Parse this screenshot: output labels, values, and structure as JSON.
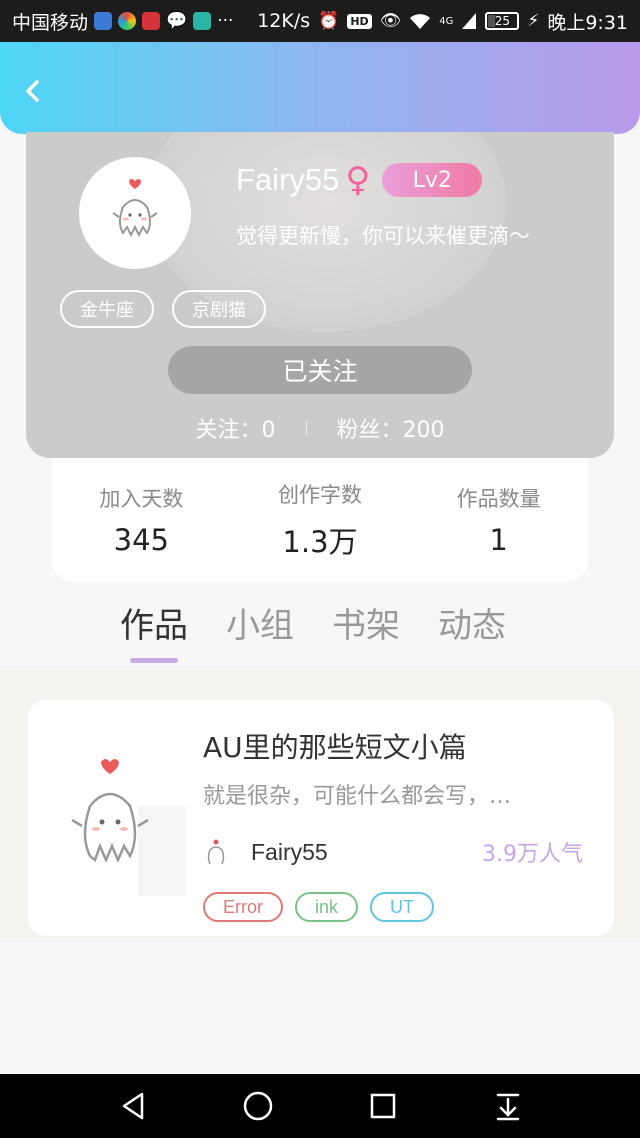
{
  "status_bar": {
    "carrier": "中国移动",
    "network_speed": "12K/s",
    "hd_label": "HD",
    "signal_label": "4G",
    "battery": "25",
    "battery_level": 0.25,
    "time": "晚上9:31"
  },
  "header": {
    "back_icon": "chevron-left-icon",
    "gradient": [
      "#4dd6f6",
      "#b99ae9"
    ]
  },
  "profile": {
    "name": "Fairy55",
    "gender_symbol": "♀",
    "level": "Lv2",
    "bio": "觉得更新慢，你可以来催更滴～",
    "tags": [
      "金牛座",
      "京剧猫"
    ],
    "follow_button": "已关注",
    "following": "关注：0",
    "fans": "粉丝：200"
  },
  "stats": [
    {
      "label": "加入天数",
      "value": "345"
    },
    {
      "label": "创作字数",
      "value": "1.3万"
    },
    {
      "label": "作品数量",
      "value": "1"
    }
  ],
  "tabs": [
    {
      "label": "作品",
      "active": true
    },
    {
      "label": "小组",
      "active": false
    },
    {
      "label": "书架",
      "active": false
    },
    {
      "label": "动态",
      "active": false
    }
  ],
  "work": {
    "title": "AU里的那些短文小篇",
    "description": "就是很杂，可能什么都会写，…",
    "author": "Fairy55",
    "popularity": "3.9万人气",
    "tags": [
      {
        "label": "Error",
        "color": "#e0787a"
      },
      {
        "label": "ink",
        "color": "#7cc08a"
      },
      {
        "label": "UT",
        "color": "#62c3e3"
      }
    ]
  },
  "nav": [
    "back-triangle-icon",
    "home-circle-icon",
    "recents-square-icon",
    "notification-down-icon"
  ]
}
